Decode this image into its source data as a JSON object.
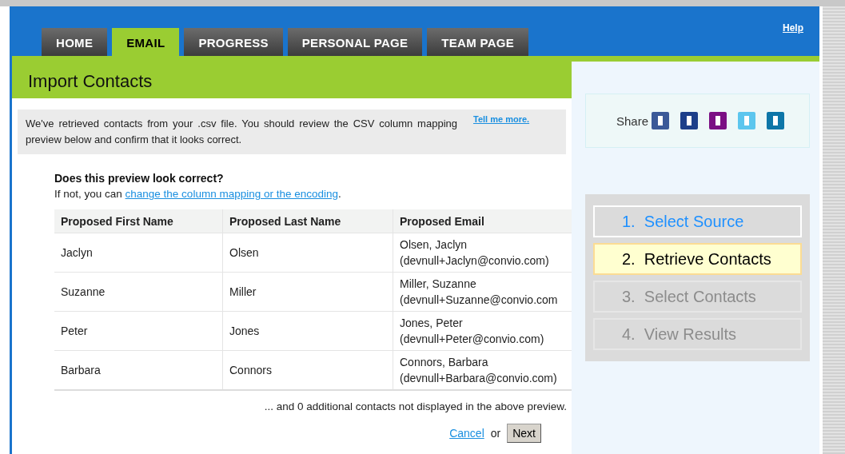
{
  "header": {
    "help_link": "Help"
  },
  "tabs": [
    {
      "label": "HOME",
      "selected": false
    },
    {
      "label": "EMAIL",
      "selected": true
    },
    {
      "label": "PROGRESS",
      "selected": false
    },
    {
      "label": "PERSONAL PAGE",
      "selected": false
    },
    {
      "label": "TEAM PAGE",
      "selected": false
    }
  ],
  "page_title": "Import Contacts",
  "info": {
    "text": "We've retrieved contacts from your .csv file. You should review the CSV column mapping preview below and confirm that it looks correct.",
    "link": "Tell me more."
  },
  "question": {
    "heading": "Does this preview look correct?",
    "prefix": "If not, you can ",
    "link": "change the column mapping or the encoding",
    "suffix": "."
  },
  "table": {
    "columns": [
      "Proposed First Name",
      "Proposed Last Name",
      "Proposed Email"
    ],
    "rows": [
      [
        "Jaclyn",
        "Olsen",
        "Olsen, Jaclyn\n(devnull+Jaclyn@convio.com)"
      ],
      [
        "Suzanne",
        "Miller",
        "Miller, Suzanne\n(devnull+Suzanne@convio.com"
      ],
      [
        "Peter",
        "Jones",
        "Jones, Peter\n(devnull+Peter@convio.com)"
      ],
      [
        "Barbara",
        "Connors",
        "Connors, Barbara\n(devnull+Barbara@convio.com)"
      ]
    ]
  },
  "footnote": "... and 0 additional contacts not displayed in the above preview.",
  "actions": {
    "cancel": "Cancel",
    "or": "or",
    "next": "Next"
  },
  "share": {
    "label": "Share",
    "icons": [
      {
        "color": "#3b5998"
      },
      {
        "color": "#1d3f8a"
      },
      {
        "color": "#7b0f84"
      },
      {
        "color": "#5cc6ee"
      },
      {
        "color": "#0e76a8"
      }
    ]
  },
  "steps": [
    {
      "label": "1.  Select Source",
      "kind": "done"
    },
    {
      "label": "2.  Retrieve Contacts",
      "kind": "current"
    },
    {
      "label": "3.  Select Contacts",
      "kind": "upcoming"
    },
    {
      "label": "4.  View Results",
      "kind": "upcoming"
    }
  ]
}
